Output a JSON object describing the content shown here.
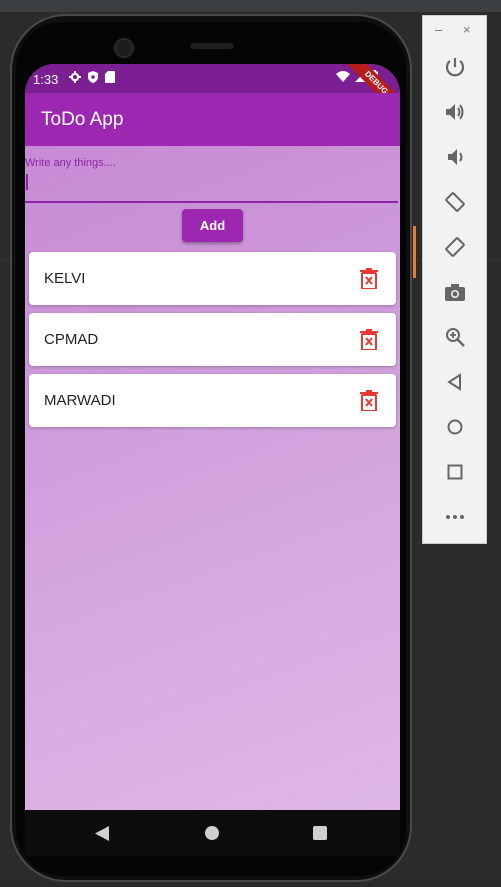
{
  "status_bar": {
    "time": "1:33"
  },
  "debug_banner": "DEBUG",
  "app_bar": {
    "title": "ToDo App"
  },
  "input": {
    "hint": "Write any things....",
    "value": ""
  },
  "add_button": {
    "label": "Add"
  },
  "todos": [
    {
      "text": "KELVI"
    },
    {
      "text": "CPMAD"
    },
    {
      "text": "MARWADI"
    }
  ],
  "emulator_window": {
    "minimize": "–",
    "close": "×"
  },
  "colors": {
    "primary": "#9c27b0",
    "status_bar": "#7b1f93",
    "delete": "#e53935",
    "background_start": "#c68ad4",
    "background_end": "#dfb7e6"
  },
  "icons": {
    "status_left": [
      "gear-icon",
      "shield-icon",
      "sd-card-icon"
    ],
    "status_right": [
      "wifi-icon",
      "signal-icon",
      "battery-icon"
    ],
    "todo_action": "delete-icon",
    "nav": [
      "back-icon",
      "home-icon",
      "recents-icon"
    ],
    "emulator": [
      "power-icon",
      "volume-up-icon",
      "volume-down-icon",
      "rotate-left-icon",
      "rotate-right-icon",
      "camera-icon",
      "zoom-icon",
      "back-icon",
      "home-icon",
      "overview-icon",
      "more-icon"
    ]
  }
}
